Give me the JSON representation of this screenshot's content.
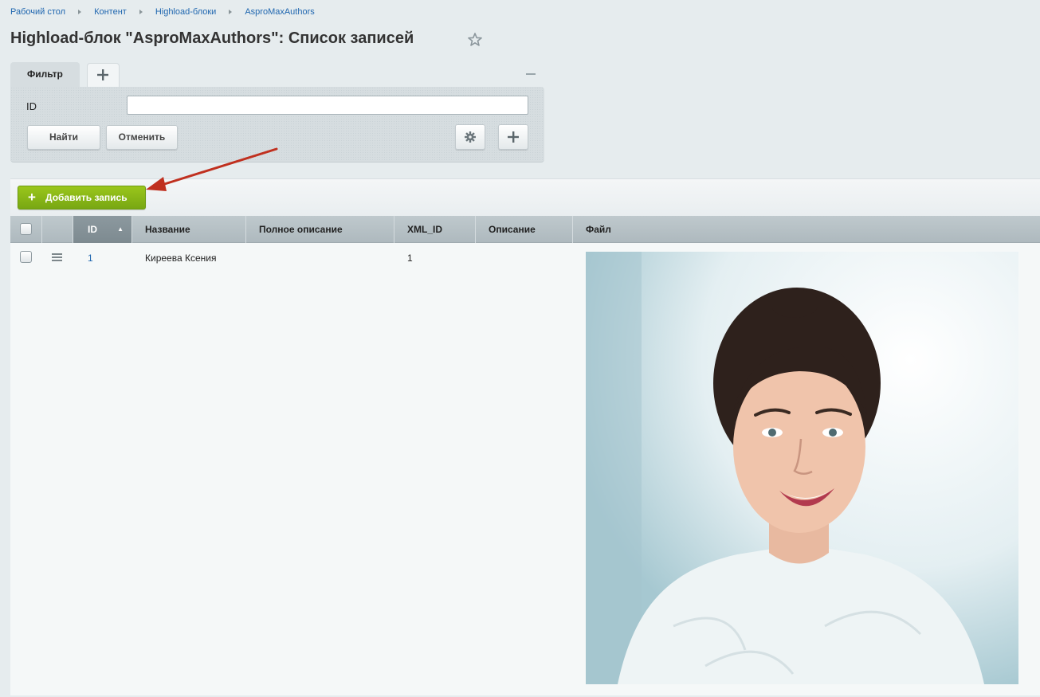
{
  "breadcrumbs": [
    "Рабочий стол",
    "Контент",
    "Highload-блоки",
    "AsproMaxAuthors"
  ],
  "page_title": "Highload-блок \"AsproMaxAuthors\": Список записей",
  "filter": {
    "tab_label": "Фильтр",
    "field_label": "ID",
    "field_value": "",
    "find_label": "Найти",
    "cancel_label": "Отменить"
  },
  "toolbar": {
    "add_label": "Добавить запись"
  },
  "table": {
    "columns": [
      "ID",
      "Название",
      "Полное описание",
      "XML_ID",
      "Описание",
      "Файл"
    ],
    "rows": [
      {
        "id": "1",
        "name": "Киреева Ксения",
        "full_description": "",
        "xml_id": "1",
        "description": ""
      }
    ]
  },
  "icons": {
    "star": "star-outline-icon",
    "gear": "gear-icon",
    "plus": "plus-icon",
    "sort": "sort-ascending-icon",
    "row_menu": "hamburger-menu-icon",
    "annotation": "red-arrow"
  },
  "colors": {
    "background": "#e6ecee",
    "link": "#2067b0",
    "add_button": "#8ab818",
    "annotation_arrow": "#c0301f"
  }
}
